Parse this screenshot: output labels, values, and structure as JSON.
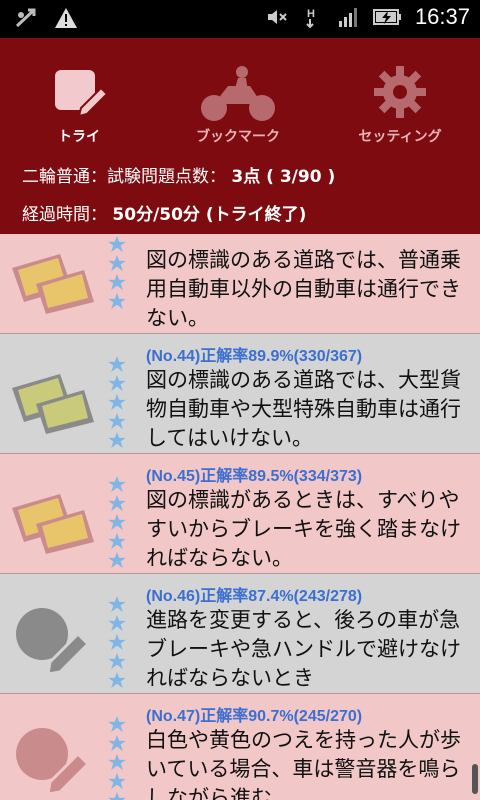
{
  "statusbar": {
    "time": "16:37"
  },
  "tabs": [
    {
      "label": "トライ"
    },
    {
      "label": "ブックマーク"
    },
    {
      "label": "セッティング"
    }
  ],
  "summary": {
    "score_label": "二輪普通：試験問題点数：",
    "score_value": "3点 ( 3/90 )",
    "time_label": "経過時間：",
    "time_value": "50分/50分 (トライ終了)"
  },
  "questions": [
    {
      "head": "",
      "text": "図の標識のある道路では、普通乗用自動車以外の自動車は通行できない。",
      "style": "pink",
      "thumb": "sign"
    },
    {
      "head": "(No.44)正解率89.9%(330/367)",
      "text": "図の標識のある道路では、大型貨物自動車や大型特殊自動車は通行してはいけない。",
      "style": "gray",
      "thumb": "sign"
    },
    {
      "head": "(No.45)正解率89.5%(334/373)",
      "text": "図の標識があるときは、すべりやすいからブレーキを強く踏まなければならない。",
      "style": "pink",
      "thumb": "sign"
    },
    {
      "head": "(No.46)正解率87.4%(243/278)",
      "text": "進路を変更すると、後ろの車が急ブレーキや急ハンドルで避けなければならないとき",
      "style": "gray",
      "thumb": "pencil"
    },
    {
      "head": "(No.47)正解率90.7%(245/270)",
      "text": "白色や黄色のつえを持った人が歩いている場合、車は警音器を鳴らしながら進む",
      "style": "pink",
      "thumb": "pencil"
    }
  ],
  "colors": {
    "header": "#7e0b10",
    "pink_row": "#f1c7c7",
    "gray_row": "#d4d4d4",
    "accent_blue": "#3b6fd2",
    "star": "#7fb6e6"
  }
}
